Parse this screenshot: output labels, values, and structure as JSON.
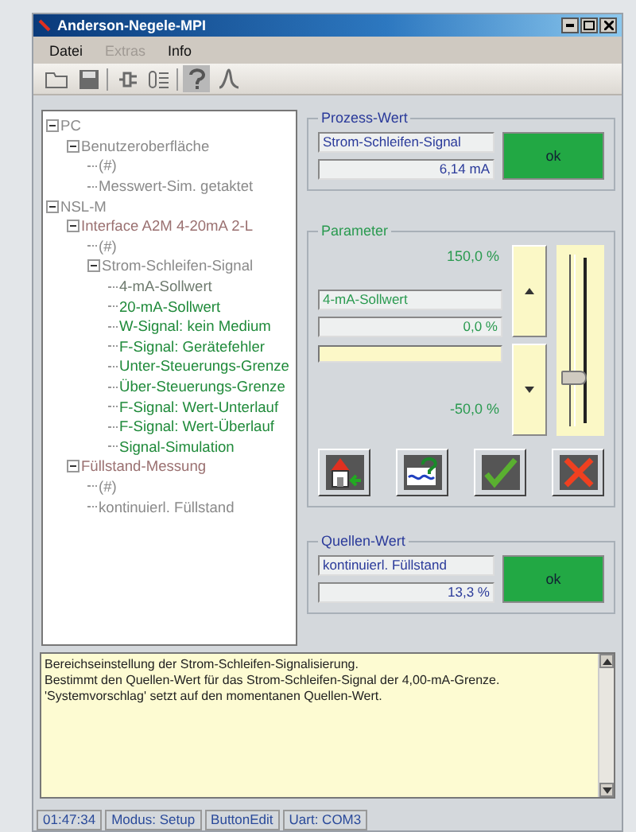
{
  "window": {
    "title": "Anderson-Negele-MPI"
  },
  "menu": [
    {
      "label": "Datei",
      "disabled": false
    },
    {
      "label": "Extras",
      "disabled": true
    },
    {
      "label": "Info",
      "disabled": false
    }
  ],
  "toolbar": [
    {
      "kind": "open"
    },
    {
      "kind": "save"
    },
    {
      "kind": "sep"
    },
    {
      "kind": "plug"
    },
    {
      "kind": "list"
    },
    {
      "kind": "sep"
    },
    {
      "kind": "help",
      "selected": true
    },
    {
      "kind": "curve"
    }
  ],
  "tree": [
    {
      "label": "PC",
      "expanded": true,
      "color": "#8a8a8a",
      "children": [
        {
          "label": "Benutzeroberfläche",
          "expanded": true,
          "color": "#8a8a8a",
          "children": [
            {
              "label": "(#)",
              "color": "#8a8a8a"
            },
            {
              "label": "Messwert-Sim. getaktet",
              "color": "#8a8a8a"
            }
          ]
        }
      ]
    },
    {
      "label": "NSL-M",
      "expanded": true,
      "color": "#8a8a8a",
      "children": [
        {
          "label": "Interface A2M 4-20mA 2-L",
          "expanded": true,
          "color": "#9a7070",
          "children": [
            {
              "label": "(#)",
              "color": "#8a8a8a"
            },
            {
              "label": "Strom-Schleifen-Signal",
              "expanded": true,
              "color": "#8a8a8a",
              "children": [
                {
                  "label": "4-mA-Sollwert",
                  "color": "#6e7a6e"
                },
                {
                  "label": "20-mA-Sollwert",
                  "color": "#1f8a3a"
                },
                {
                  "label": "W-Signal: kein Medium",
                  "color": "#1f8a3a"
                },
                {
                  "label": "F-Signal: Gerätefehler",
                  "color": "#1f8a3a"
                },
                {
                  "label": "Unter-Steuerungs-Grenze",
                  "color": "#1f8a3a"
                },
                {
                  "label": "Über-Steuerungs-Grenze",
                  "color": "#1f8a3a"
                },
                {
                  "label": "F-Signal: Wert-Unterlauf",
                  "color": "#1f8a3a"
                },
                {
                  "label": "F-Signal: Wert-Überlauf",
                  "color": "#1f8a3a"
                },
                {
                  "label": "Signal-Simulation",
                  "color": "#1f8a3a"
                }
              ]
            }
          ]
        },
        {
          "label": "Füllstand-Messung",
          "expanded": true,
          "color": "#9a7070",
          "children": [
            {
              "label": "(#)",
              "color": "#8a8a8a"
            },
            {
              "label": "kontinuierl. Füllstand",
              "color": "#8a8a8a"
            }
          ]
        }
      ]
    }
  ],
  "process_value": {
    "title": "Prozess-Wert",
    "name": "Strom-Schleifen-Signal",
    "value": "6,14 mA",
    "status": "ok"
  },
  "parameter": {
    "title": "Parameter",
    "max": "150,0 %",
    "name": "4-mA-Sollwert",
    "value": "0,0 %",
    "min": "-50,0 %",
    "level": 0.25,
    "actions": [
      {
        "kind": "home"
      },
      {
        "kind": "suggest"
      },
      {
        "kind": "accept"
      },
      {
        "kind": "cancel"
      }
    ]
  },
  "source_value": {
    "title": "Quellen-Wert",
    "name": "kontinuierl. Füllstand",
    "value": "13,3 %",
    "status": "ok"
  },
  "description": "Bereichseinstellung der Strom-Schleifen-Signalisierung.\nBestimmt den Quellen-Wert für das Strom-Schleifen-Signal der 4,00-mA-Grenze. 'Systemvorschlag' setzt auf den momentanen Quellen-Wert.",
  "status_bar": [
    "01:47:34",
    "Modus: Setup",
    "ButtonEdit",
    "Uart: COM3"
  ]
}
